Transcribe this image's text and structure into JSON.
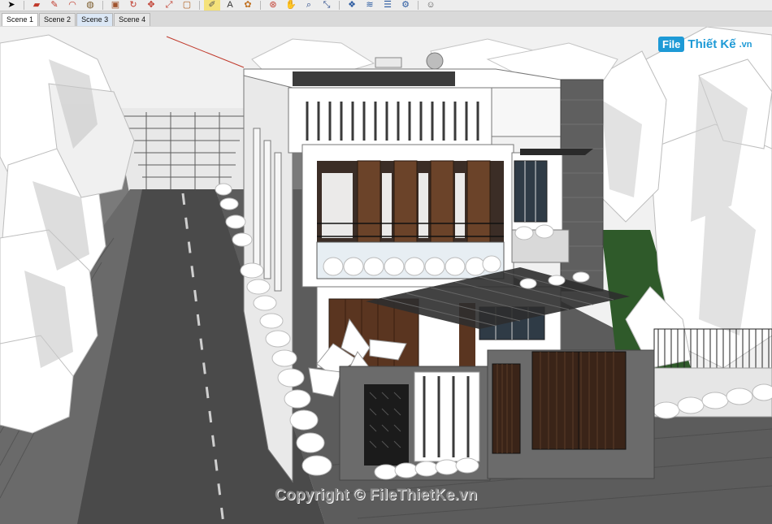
{
  "app": {
    "toolbar_icons": [
      "select-arrow-icon",
      "eraser-icon",
      "pencil-line-icon",
      "arc-icon",
      "paint-bucket-icon",
      "push-pull-icon",
      "rotate-icon",
      "move-icon",
      "scale-icon",
      "offset-icon",
      "tape-measure-icon",
      "text-icon",
      "paint-icon",
      "orbit-icon",
      "pan-icon",
      "zoom-icon",
      "zoom-extents-icon",
      "component-icon",
      "layers-icon",
      "styles-icon",
      "settings-icon",
      "user-icon"
    ]
  },
  "scenes": {
    "tabs": [
      {
        "label": "Scene 1",
        "active": true
      },
      {
        "label": "Scene 2",
        "active": false
      },
      {
        "label": "Scene 3",
        "active": false
      },
      {
        "label": "Scene 4",
        "active": false
      }
    ]
  },
  "watermark": {
    "logo_mark": "File",
    "logo_text": "Thiết Kế",
    "logo_tld": ".vn",
    "copyright": "Copyright © FileThietKe.vn"
  },
  "colors": {
    "sky": "#f2f2f2",
    "road": "#4a4a4a",
    "facade_white": "#ffffff",
    "wood": "#5a3520",
    "stone_grey": "#6b6b6b",
    "lawn": "#2f5a2a",
    "accent": "#1e9ad6"
  }
}
